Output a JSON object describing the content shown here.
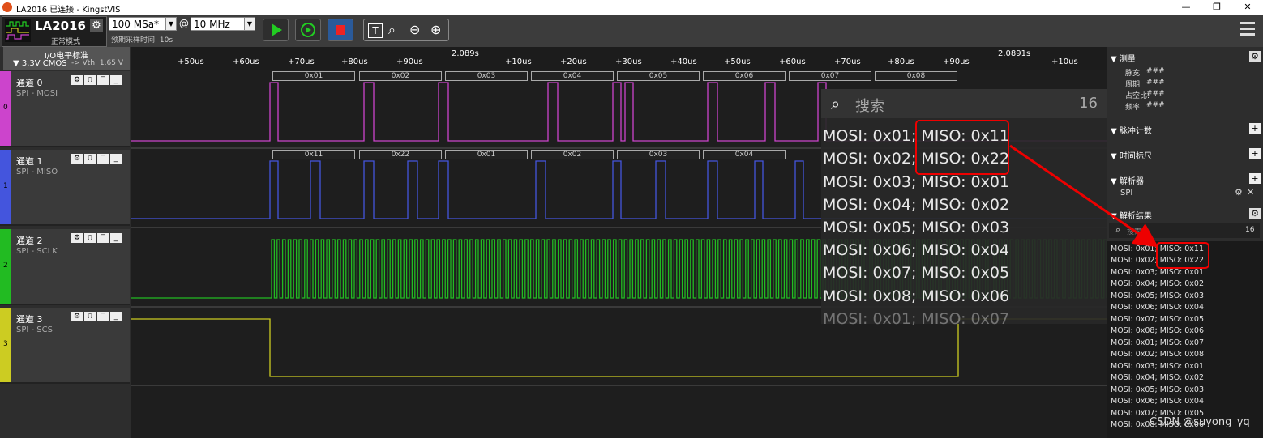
{
  "window": {
    "title": "LA2016 已连接 - KingstVIS"
  },
  "toolbar": {
    "device_name": "LA2016",
    "device_mode": "正常模式",
    "sample_rate": "100 MSa*",
    "at": "@",
    "frequency": "10 MHz",
    "estimated_time": "预期采样时间: 10s"
  },
  "io_standard": {
    "header": "I/O电平标准",
    "value": "▼ 3.3V CMOS",
    "vth": "-> Vth: 1.65 V"
  },
  "ruler": {
    "ticks": [
      "+50us",
      "+60us",
      "+70us",
      "+80us",
      "+90us",
      "+10us",
      "+20us",
      "+30us",
      "+40us",
      "+50us",
      "+60us",
      "+70us",
      "+80us",
      "+90us",
      "+10us"
    ],
    "markers": [
      "2.089s",
      "2.0891s"
    ]
  },
  "channels": [
    {
      "index": "0",
      "name": "通道 0",
      "protocol": "SPI - MOSI",
      "color": "#cc44cc"
    },
    {
      "index": "1",
      "name": "通道 1",
      "protocol": "SPI - MISO",
      "color": "#4455dd"
    },
    {
      "index": "2",
      "name": "通道 2",
      "protocol": "SPI - SCLK",
      "color": "#22bb22"
    },
    {
      "index": "3",
      "name": "通道 3",
      "protocol": "SPI - SCS",
      "color": "#cccc22"
    }
  ],
  "decode_mosi": [
    "0x01",
    "0x02",
    "0x03",
    "0x04",
    "0x05",
    "0x06",
    "0x07",
    "0x08"
  ],
  "decode_miso": [
    "0x11",
    "0x22",
    "0x01",
    "0x02",
    "0x03",
    "0x04"
  ],
  "zoom": {
    "search_placeholder": "搜索",
    "count": "16",
    "rows": [
      "MOSI: 0x01;  MISO: 0x11",
      "MOSI: 0x02;  MISO: 0x22",
      "MOSI: 0x03;  MISO: 0x01",
      "MOSI: 0x04;  MISO: 0x02",
      "MOSI: 0x05;  MISO: 0x03",
      "MOSI: 0x06;  MISO: 0x04",
      "MOSI: 0x07;  MISO: 0x05",
      "MOSI: 0x08;  MISO: 0x06",
      "MOSI: 0x01;  MISO: 0x07"
    ]
  },
  "right": {
    "measure_title": "测量",
    "measure": [
      {
        "label": "脉宽:",
        "value": "###"
      },
      {
        "label": "周期:",
        "value": "###"
      },
      {
        "label": "占空比:",
        "value": "###"
      },
      {
        "label": "频率:",
        "value": "###"
      }
    ],
    "pulse_count": "脉冲计数",
    "time_marker": "时间标尺",
    "analyzer": "解析器",
    "analyzer_item": "SPI",
    "results_title": "解析结果",
    "search_placeholder": "搜索",
    "count": "16",
    "results": [
      "MOSI: 0x01;  MISO: 0x11",
      "MOSI: 0x02;  MISO: 0x22",
      "MOSI: 0x03;  MISO: 0x01",
      "MOSI: 0x04;  MISO: 0x02",
      "MOSI: 0x05;  MISO: 0x03",
      "MOSI: 0x06;  MISO: 0x04",
      "MOSI: 0x07;  MISO: 0x05",
      "MOSI: 0x08;  MISO: 0x06",
      "MOSI: 0x01;  MISO: 0x07",
      "MOSI: 0x02;  MISO: 0x08",
      "MOSI: 0x03;  MISO: 0x01",
      "MOSI: 0x04;  MISO: 0x02",
      "MOSI: 0x05;  MISO: 0x03",
      "MOSI: 0x06;  MISO: 0x04",
      "MOSI: 0x07;  MISO: 0x05",
      "MOSI: 0x08;  MISO: 0x06"
    ]
  },
  "watermark": "CSDN @suyong_yq"
}
